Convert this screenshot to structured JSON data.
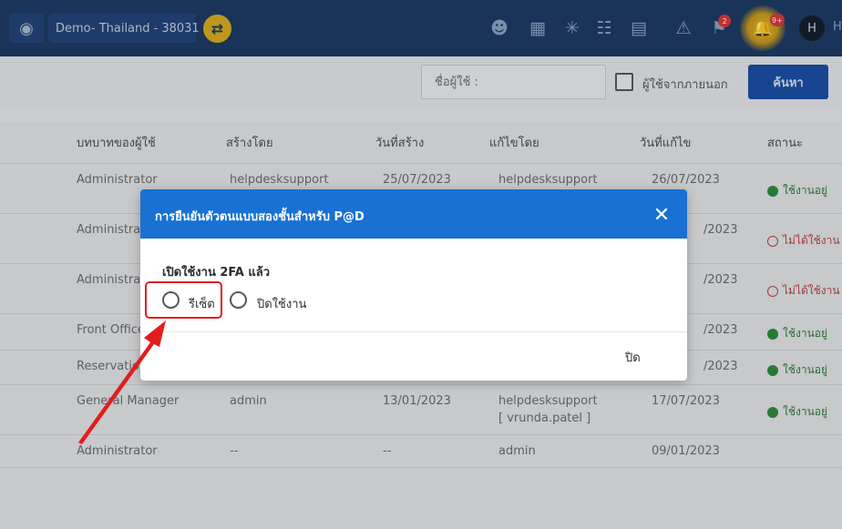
{
  "topbar": {
    "property": "Demo- Thailand - ",
    "property_code": "38031",
    "flag_badge": "2",
    "bell_badge": "9+",
    "avatar_letter": "H",
    "user_fragment": "H"
  },
  "search": {
    "username_placeholder": "ชื่อผู้ใช้ :",
    "external_label": "ผู้ใช้จากภายนอก",
    "search_button": "ค้นหา"
  },
  "table": {
    "headers": [
      "บทบาทของผู้ใช้",
      "สร้างโดย",
      "วันที่สร้าง",
      "แก้ไขโดย",
      "วันที่แก้ไข",
      "สถานะ"
    ],
    "rows": [
      {
        "role": "Administrator",
        "created_by": "helpdesksupport",
        "created_date": "25/07/2023",
        "modified_by": "helpdesksupport",
        "modified_date": "26/07/2023",
        "status": "ใช้งานอยู่",
        "active": true
      },
      {
        "role": "Administrator",
        "created_by": "",
        "created_date": "",
        "modified_by": "",
        "modified_date": "",
        "status": "ไม่ได้ใช้งาน",
        "active": false
      },
      {
        "role": "Administrator",
        "created_by": "",
        "created_date": "",
        "modified_by": "",
        "modified_date": "",
        "status": "ไม่ได้ใช้งาน",
        "active": false
      },
      {
        "role": "Front Office",
        "created_by": "",
        "created_date": "",
        "modified_by": "",
        "modified_date": "",
        "status": "ใช้งานอยู่",
        "active": true
      },
      {
        "role": "Reservation",
        "created_by": "",
        "created_date": "",
        "modified_by": "",
        "modified_date": "",
        "status": "ใช้งานอยู่",
        "active": true
      },
      {
        "role": "General Manager",
        "created_by": "admin",
        "created_date": "13/01/2023",
        "modified_by": "helpdesksupport",
        "modified_by_2": "[ vrunda.patel ]",
        "modified_date": "17/07/2023",
        "status": "ใช้งานอยู่",
        "active": true
      },
      {
        "role": "Administrator",
        "created_by": "--",
        "created_date": "--",
        "modified_by": "admin",
        "modified_date": "09/01/2023",
        "status": "",
        "active": null
      }
    ],
    "modified_date_partial": [
      "/2023",
      "/2023",
      "/2023",
      "/2023"
    ]
  },
  "modal": {
    "title": "การยืนยันตัวตนแบบสองชั้นสำหรับ P@D",
    "label": "เปิดใช้งาน 2FA แล้ว",
    "option_reset": "รีเซ็ต",
    "option_disable": "ปิดใช้งาน",
    "close_button": "ปิด"
  },
  "colors": {
    "topbar": "#1d3b66",
    "modal_header": "#1971d4",
    "primary_button": "#1b4fa5",
    "active_status": "#2f7d3d",
    "inactive_status": "#b94444",
    "annotation": "#e21d1d"
  }
}
